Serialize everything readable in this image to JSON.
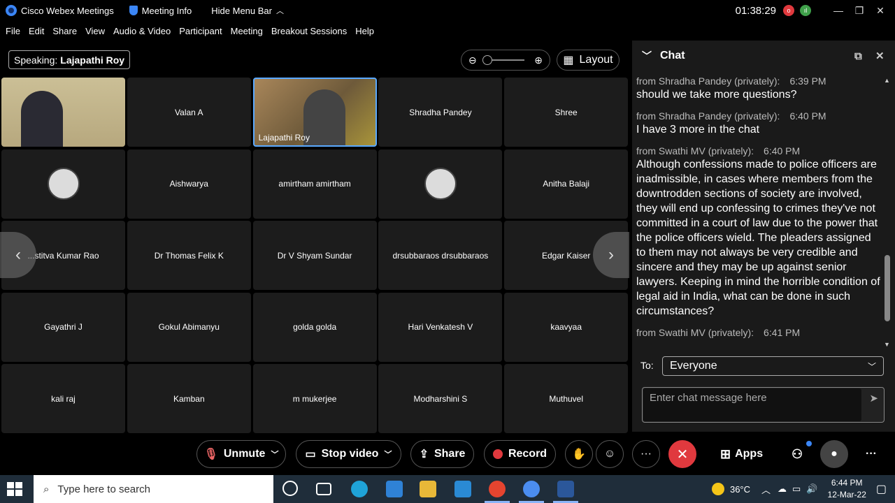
{
  "titlebar": {
    "app_title": "Cisco Webex Meetings",
    "meeting_info": "Meeting Info",
    "hide_menu": "Hide Menu Bar",
    "clock": "01:38:29",
    "badge1": "o",
    "badge2": "ıl"
  },
  "menu": [
    "File",
    "Edit",
    "Share",
    "View",
    "Audio & Video",
    "Participant",
    "Meeting",
    "Breakout Sessions",
    "Help"
  ],
  "speaking": {
    "label": "Speaking:",
    "name": "Lajapathi Roy"
  },
  "layout_label": "Layout",
  "tiles": [
    {
      "name": "",
      "kind": "self"
    },
    {
      "name": "Valan A"
    },
    {
      "name": "Lajapathi Roy",
      "kind": "active"
    },
    {
      "name": "Shradha Pandey"
    },
    {
      "name": "Shree"
    },
    {
      "name": "",
      "kind": "avatar"
    },
    {
      "name": "Aishwarya"
    },
    {
      "name": "amirtham amirtham"
    },
    {
      "name": "",
      "kind": "avatar"
    },
    {
      "name": "Anitha Balaji"
    },
    {
      "name": "...stitva Kumar Rao"
    },
    {
      "name": "Dr Thomas Felix K"
    },
    {
      "name": "Dr V Shyam Sundar"
    },
    {
      "name": "drsubbaraos drsubbaraos"
    },
    {
      "name": "Edgar Kaiser"
    },
    {
      "name": "Gayathri J"
    },
    {
      "name": "Gokul Abimanyu"
    },
    {
      "name": "golda golda"
    },
    {
      "name": "Hari Venkatesh V"
    },
    {
      "name": "kaavyaa"
    },
    {
      "name": "kali raj"
    },
    {
      "name": "Kamban"
    },
    {
      "name": "m mukerjee"
    },
    {
      "name": "Modharshini S"
    },
    {
      "name": "Muthuvel"
    }
  ],
  "chat": {
    "title": "Chat",
    "messages": [
      {
        "from": "from Shradha Pandey (privately):",
        "time": "6:39 PM",
        "text": "should we take more questions?"
      },
      {
        "from": "from Shradha Pandey (privately):",
        "time": "6:40 PM",
        "text": "I have 3 more in the chat"
      },
      {
        "from": "from Swathi MV (privately):",
        "time": "6:40 PM",
        "text": "Although confessions made to police officers are inadmissible, in cases where members from the downtrodden sections of society are involved, they will end up confessing to crimes they've not committed in a court of law due to the power that the police officers wield. The pleaders assigned to them may not always be very credible and sincere and they may be up against senior lawyers. Keeping in mind the horrible condition of legal aid in India, what can be done in such circumstances?"
      },
      {
        "from": "from Swathi MV (privately):",
        "time": "6:41 PM",
        "text": ""
      }
    ],
    "to_label": "To:",
    "to_value": "Everyone",
    "input_placeholder": "Enter chat message here"
  },
  "controls": {
    "unmute": "Unmute",
    "stop_video": "Stop video",
    "share": "Share",
    "record": "Record",
    "apps": "Apps",
    "more": "···"
  },
  "taskbar": {
    "search_placeholder": "Type here to search",
    "temperature": "36°C",
    "time": "6:44 PM",
    "date": "12-Mar-22"
  },
  "colors": {
    "end_button": "#e0393e",
    "active_border": "#5aa9ff",
    "record_dot": "#e0393e"
  }
}
